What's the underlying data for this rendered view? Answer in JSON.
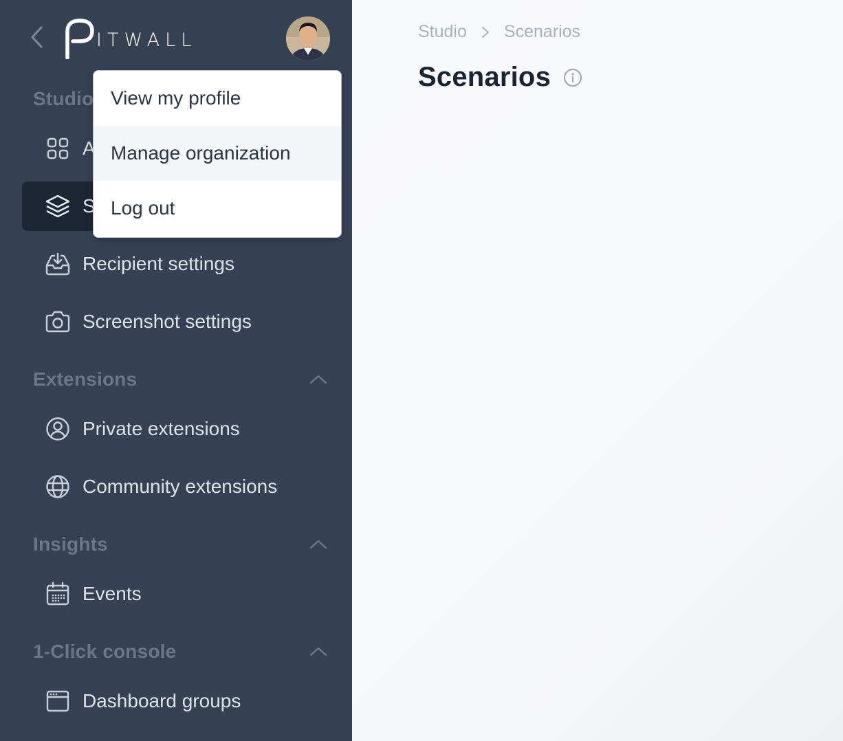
{
  "sidebar": {
    "logo_text": "ITWALL",
    "logo_letter": "P",
    "sections": {
      "studio": {
        "label": "Studio"
      },
      "extensions": {
        "label": "Extensions"
      },
      "insights": {
        "label": "Insights"
      },
      "console": {
        "label": "1-Click console"
      }
    },
    "items": [
      {
        "label": "A",
        "icon": "grid-icon"
      },
      {
        "label": "S",
        "icon": "layers-icon",
        "active": true
      },
      {
        "label": "Recipient settings",
        "icon": "inbox-download-icon"
      },
      {
        "label": "Screenshot settings",
        "icon": "camera-icon"
      },
      {
        "label": "Private extensions",
        "icon": "user-circle-icon"
      },
      {
        "label": "Community extensions",
        "icon": "globe-icon"
      },
      {
        "label": "Events",
        "icon": "calendar-icon"
      },
      {
        "label": "Dashboard groups",
        "icon": "browser-window-icon"
      }
    ]
  },
  "user_menu": {
    "items": [
      {
        "label": "View my profile"
      },
      {
        "label": "Manage organization",
        "highlighted": true
      },
      {
        "label": "Log out"
      }
    ]
  },
  "main": {
    "breadcrumb": [
      "Studio",
      "Scenarios"
    ],
    "title": "Scenarios"
  },
  "colors": {
    "sidebar_bg": "#364153",
    "sidebar_active_bg": "#1d2635",
    "section_label": "#6b778a",
    "main_bg": "#f8f9fb",
    "title": "#1b2433"
  }
}
